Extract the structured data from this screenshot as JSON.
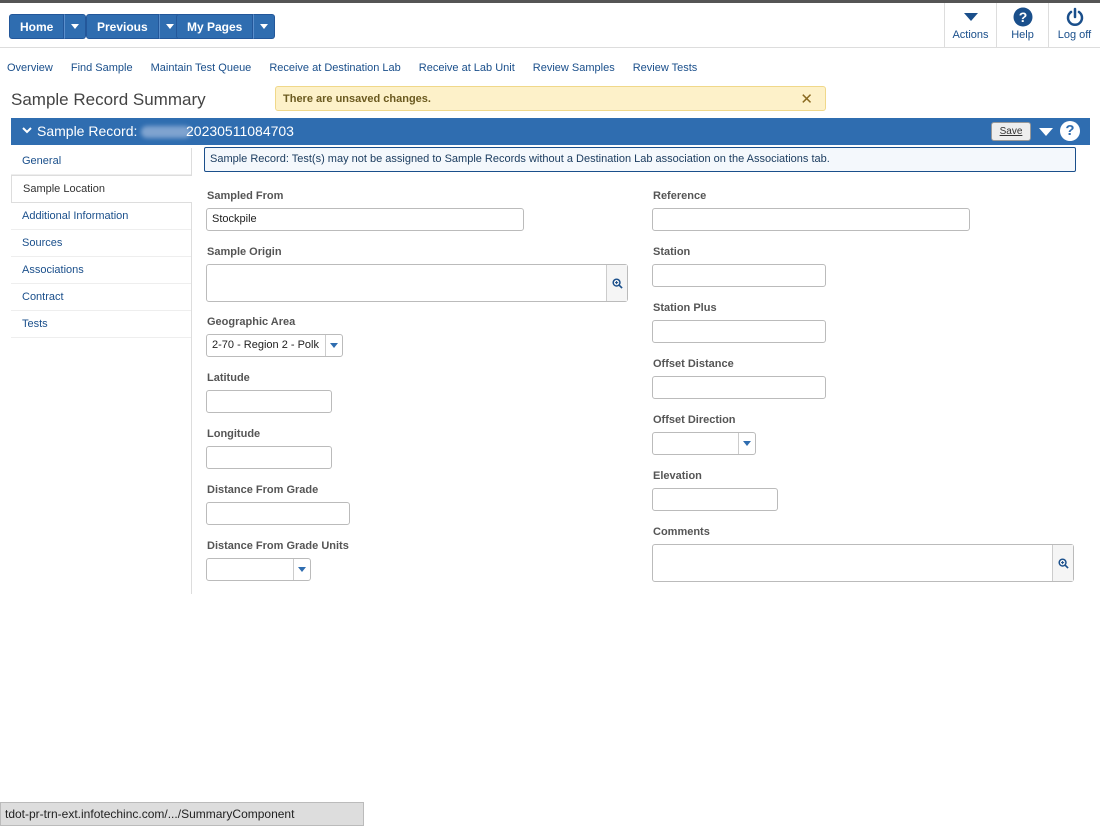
{
  "header": {
    "home_label": "Home",
    "previous_label": "Previous",
    "mypages_label": "My Pages",
    "actions_label": "Actions",
    "help_label": "Help",
    "logoff_label": "Log off"
  },
  "nav_links": [
    "Overview",
    "Find Sample",
    "Maintain Test Queue",
    "Receive at Destination Lab",
    "Receive at Lab Unit",
    "Review Samples",
    "Review Tests"
  ],
  "page_title": "Sample Record Summary",
  "unsaved_message": "There are unsaved changes.",
  "record": {
    "label": "Sample Record:",
    "number": "20230511084703",
    "save_label": "Save"
  },
  "side_nav": [
    "General",
    "Sample Location",
    "Additional Information",
    "Sources",
    "Associations",
    "Contract",
    "Tests"
  ],
  "active_tab": "Sample Location",
  "info_message": "Sample Record: Test(s) may not be assigned to Sample Records without a Destination Lab association on the Associations tab.",
  "left_fields": {
    "sampled_from": {
      "label": "Sampled From",
      "value": "Stockpile"
    },
    "sample_origin": {
      "label": "Sample Origin",
      "value": ""
    },
    "geographic_area": {
      "label": "Geographic Area",
      "value": "2-70 - Region 2 - Polk"
    },
    "latitude": {
      "label": "Latitude",
      "value": ""
    },
    "longitude": {
      "label": "Longitude",
      "value": ""
    },
    "distance_from_grade": {
      "label": "Distance From Grade",
      "value": ""
    },
    "distance_from_grade_units": {
      "label": "Distance From Grade Units",
      "value": ""
    }
  },
  "right_fields": {
    "reference": {
      "label": "Reference",
      "value": ""
    },
    "station": {
      "label": "Station",
      "value": ""
    },
    "station_plus": {
      "label": "Station Plus",
      "value": ""
    },
    "offset_distance": {
      "label": "Offset Distance",
      "value": ""
    },
    "offset_direction": {
      "label": "Offset Direction",
      "value": ""
    },
    "elevation": {
      "label": "Elevation",
      "value": ""
    },
    "comments": {
      "label": "Comments",
      "value": ""
    }
  },
  "status_url": "tdot-pr-trn-ext.infotechinc.com/.../SummaryComponent",
  "colors": {
    "primary": "#2f6db0",
    "link": "#1a4f8b",
    "warning_bg": "#fdf1c9"
  },
  "icons": [
    "chevron-down-icon",
    "question-circle-icon",
    "power-icon",
    "zoom-icon",
    "close-icon"
  ]
}
